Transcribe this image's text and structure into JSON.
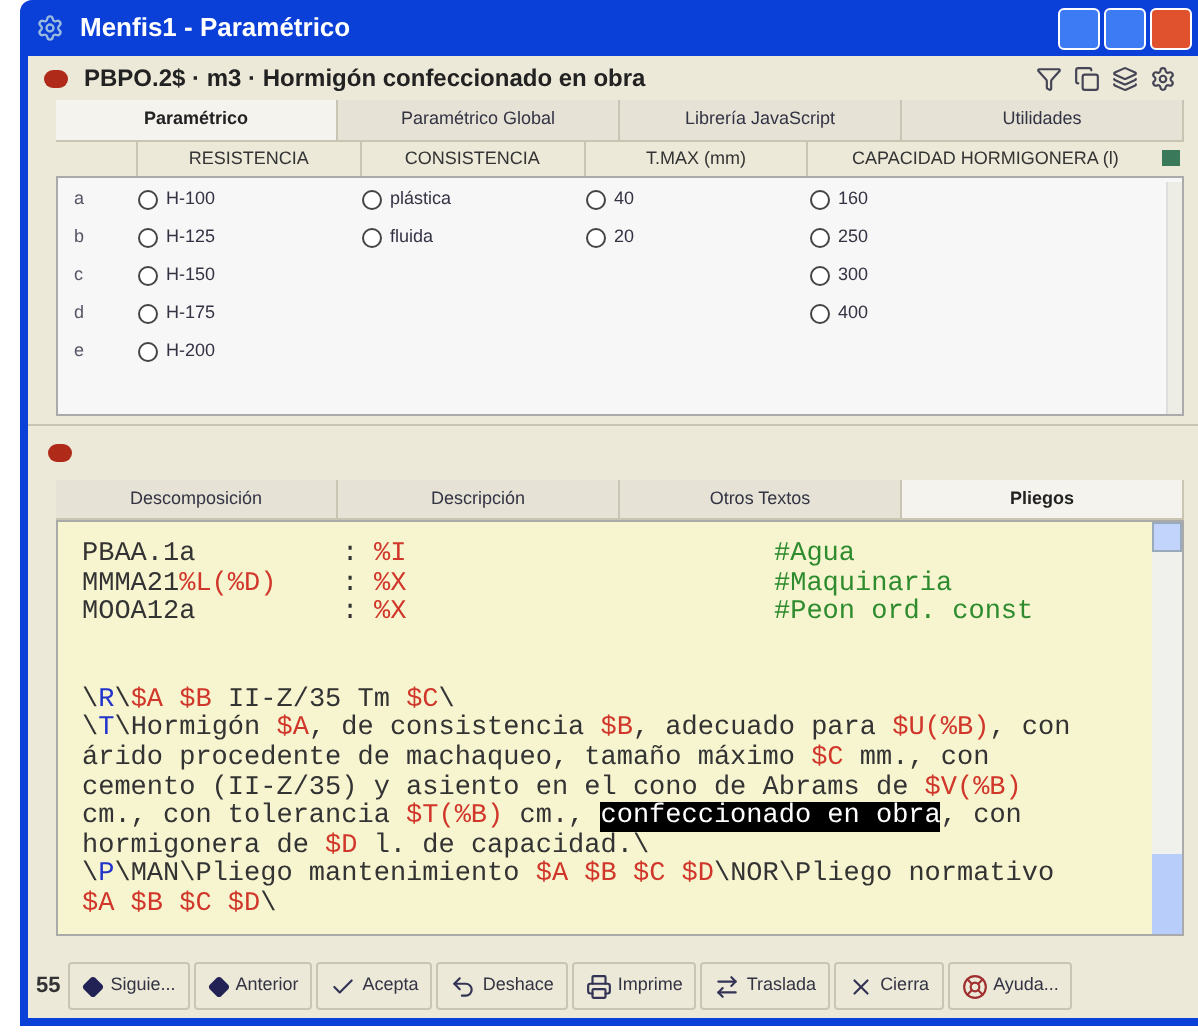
{
  "window": {
    "title": "Menfis1 - Paramétrico"
  },
  "header": {
    "title": "PBPO.2$ · m3 · Hormigón confeccionado en obra"
  },
  "tabs": [
    {
      "label": "Paramétrico",
      "selected": true
    },
    {
      "label": "Paramétrico Global",
      "selected": false
    },
    {
      "label": "Librería JavaScript",
      "selected": false
    },
    {
      "label": "Utilidades",
      "selected": false
    }
  ],
  "table": {
    "columns": [
      "RESISTENCIA",
      "CONSISTENCIA",
      "T.MAX (mm)",
      "CAPACIDAD HORMIGONERA (l)"
    ],
    "rows": [
      {
        "label": "a",
        "cells": [
          {
            "text": "H-100",
            "selected": false
          },
          {
            "text": "plástica",
            "selected": false
          },
          {
            "text": "40",
            "selected": false
          },
          {
            "text": "160",
            "selected": false
          }
        ]
      },
      {
        "label": "b",
        "cells": [
          {
            "text": "H-125",
            "selected": false
          },
          {
            "text": "fluida",
            "selected": false
          },
          {
            "text": "20",
            "selected": false
          },
          {
            "text": "250",
            "selected": false
          }
        ]
      },
      {
        "label": "c",
        "cells": [
          {
            "text": "H-150",
            "selected": false
          },
          null,
          null,
          {
            "text": "300",
            "selected": false
          }
        ]
      },
      {
        "label": "d",
        "cells": [
          {
            "text": "H-175",
            "selected": false
          },
          null,
          null,
          {
            "text": "400",
            "selected": false
          }
        ]
      },
      {
        "label": "e",
        "cells": [
          {
            "text": "H-200",
            "selected": false
          },
          null,
          null,
          null
        ]
      }
    ]
  },
  "lower_tabs": [
    {
      "label": "Descomposición",
      "selected": false
    },
    {
      "label": "Descripción",
      "selected": false
    },
    {
      "label": "Otros Textos",
      "selected": false
    },
    {
      "label": "Pliegos",
      "selected": true
    }
  ],
  "editor": {
    "rows": [
      {
        "name": [
          {
            "kind": "text",
            "text": "PBAA.1a"
          }
        ],
        "separator": ":",
        "value": "%I",
        "comment": "#Agua"
      },
      {
        "name": [
          {
            "kind": "text",
            "text": "MMMA21"
          },
          {
            "kind": "param",
            "text": "%L(%D)"
          }
        ],
        "separator": ":",
        "value": "%X",
        "comment": "#Maquinaria"
      },
      {
        "name": [
          {
            "kind": "text",
            "text": "MOOA12a"
          }
        ],
        "separator": ":",
        "value": "%X",
        "comment": "#Peon ord. const"
      }
    ],
    "lines": [
      [
        {
          "kind": "text",
          "text": "\\"
        },
        {
          "kind": "tag",
          "text": "R"
        },
        {
          "kind": "text",
          "text": "\\"
        },
        {
          "kind": "param",
          "text": "$A $B"
        },
        {
          "kind": "text",
          "text": " II-Z/35 Tm "
        },
        {
          "kind": "param",
          "text": "$C"
        },
        {
          "kind": "text",
          "text": "\\"
        }
      ],
      [
        {
          "kind": "text",
          "text": "\\"
        },
        {
          "kind": "tag",
          "text": "T"
        },
        {
          "kind": "text",
          "text": "\\Hormigón "
        },
        {
          "kind": "param",
          "text": "$A"
        },
        {
          "kind": "text",
          "text": ", de consistencia "
        },
        {
          "kind": "param",
          "text": "$B"
        },
        {
          "kind": "text",
          "text": ", adecuado para "
        },
        {
          "kind": "param",
          "text": "$U(%B)"
        },
        {
          "kind": "text",
          "text": ", con"
        }
      ],
      [
        {
          "kind": "text",
          "text": "árido procedente de machaqueo, tamaño máximo "
        },
        {
          "kind": "param",
          "text": "$C"
        },
        {
          "kind": "text",
          "text": " mm., con"
        }
      ],
      [
        {
          "kind": "text",
          "text": "cemento (II-Z/35) y asiento en el cono de Abrams de "
        },
        {
          "kind": "param",
          "text": "$V(%B)"
        }
      ],
      [
        {
          "kind": "text",
          "text": "cm., con tolerancia "
        },
        {
          "kind": "param",
          "text": "$T(%B)"
        },
        {
          "kind": "text",
          "text": " cm., "
        },
        {
          "kind": "selection",
          "text": "confeccionado en obra"
        },
        {
          "kind": "text",
          "text": ", con"
        }
      ],
      [
        {
          "kind": "text",
          "text": "hormigonera de "
        },
        {
          "kind": "param",
          "text": "$D"
        },
        {
          "kind": "text",
          "text": " l. de capacidad.\\"
        }
      ],
      [
        {
          "kind": "text",
          "text": "\\"
        },
        {
          "kind": "tag",
          "text": "P"
        },
        {
          "kind": "text",
          "text": "\\MAN\\Pliego mantenimiento "
        },
        {
          "kind": "param",
          "text": "$A $B $C $D"
        },
        {
          "kind": "text",
          "text": "\\NOR\\Pliego normativo"
        }
      ],
      [
        {
          "kind": "param",
          "text": "$A $B $C $D"
        },
        {
          "kind": "text",
          "text": "\\"
        }
      ]
    ]
  },
  "toolbar": {
    "count": "55",
    "buttons": [
      "Siguie...",
      "Anterior",
      "Acepta",
      "Deshace",
      "Imprime",
      "Traslada",
      "Cierra",
      "Ayuda..."
    ]
  }
}
